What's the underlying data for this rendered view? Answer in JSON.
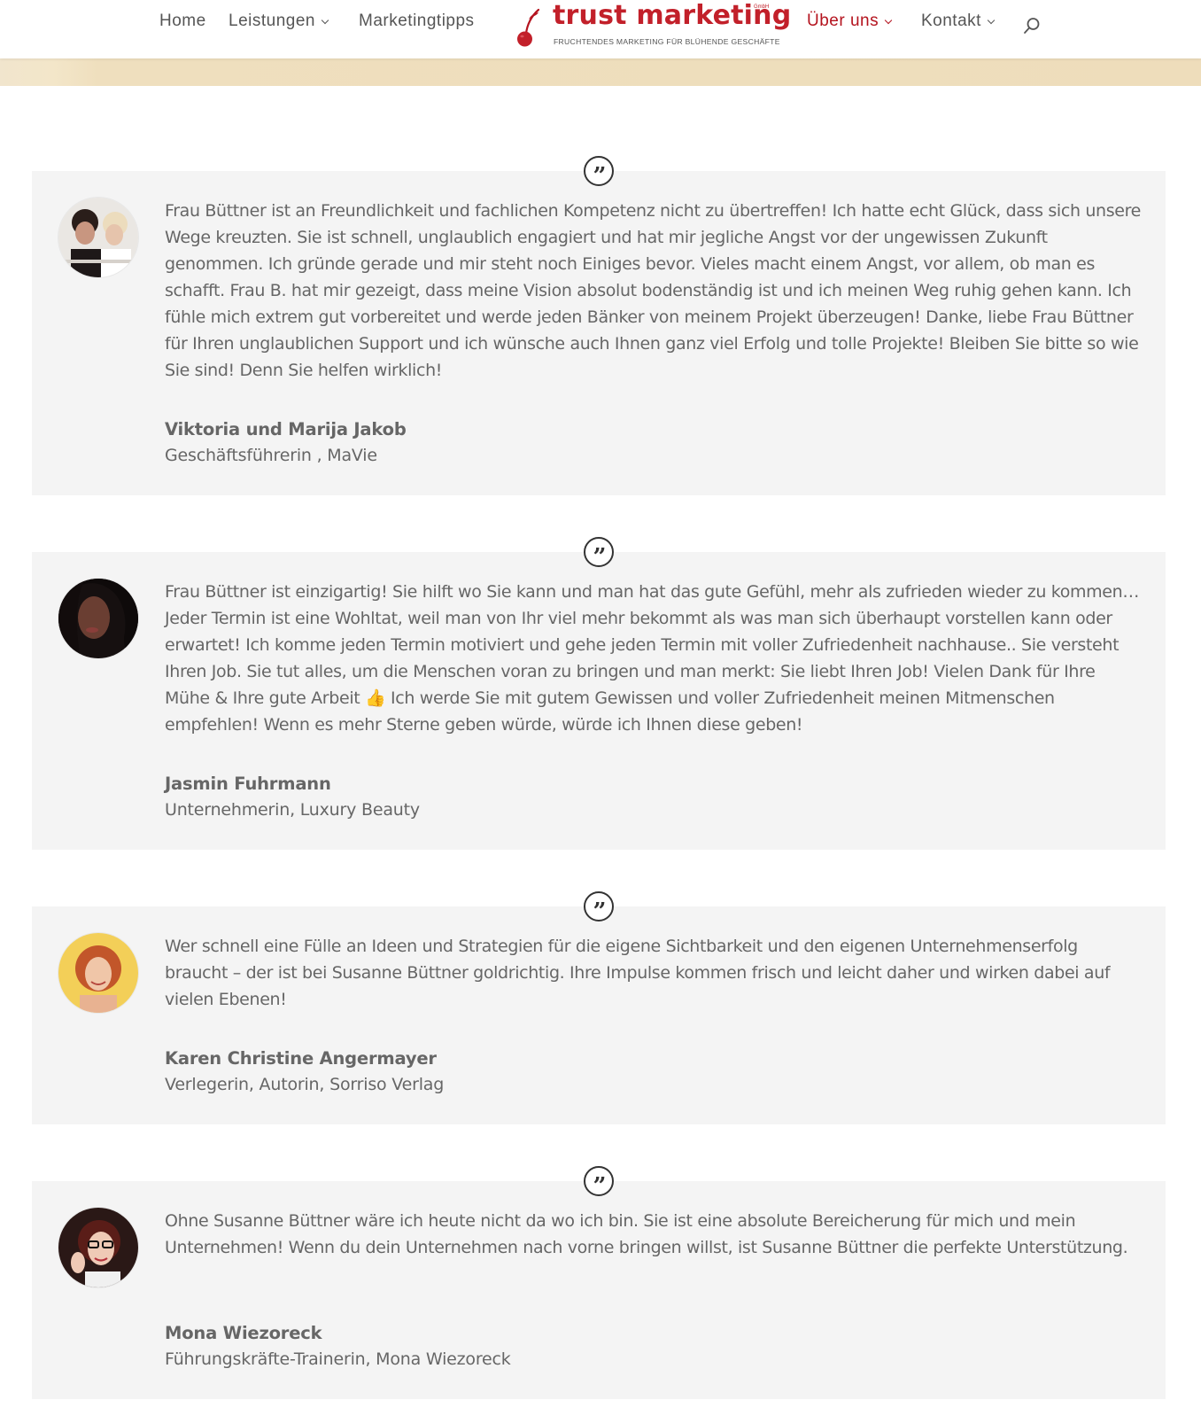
{
  "nav": {
    "left": [
      {
        "label": "Home",
        "has_dropdown": false
      },
      {
        "label": "Leistungen",
        "has_dropdown": true
      },
      {
        "label": "Marketingtipps",
        "has_dropdown": false
      }
    ],
    "right": [
      {
        "label": "Über uns",
        "has_dropdown": true,
        "active": true
      },
      {
        "label": "Kontakt",
        "has_dropdown": true
      }
    ]
  },
  "logo": {
    "name": "trust marketing",
    "suffix": "GmbH",
    "tagline": "FRUCHTENDES MARKETING FÜR BLÜHENDE GESCHÄFTE",
    "icon": "cherry-icon"
  },
  "icons": {
    "search": "search-icon",
    "quote": "quote-icon",
    "dropdown": "chevron-down-icon"
  },
  "quote_mark": "”",
  "colors": {
    "brand": "#c2202a",
    "nav_active": "#b4131e",
    "card_bg": "#f4f4f4",
    "text": "#666666",
    "banner": "#efdfbe"
  },
  "testimonials": [
    {
      "text": "Frau Büttner ist an Freundlichkeit und fachlichen Kompetenz nicht zu übertreffen! Ich hatte echt Glück, dass sich unsere Wege kreuzten. Sie ist schnell, unglaublich engagiert und hat mir jegliche Angst vor der ungewissen Zukunft genommen. Ich gründe gerade und mir steht noch Einiges bevor. Vieles macht einem Angst, vor allem, ob man es schafft. Frau B. hat mir gezeigt, dass meine Vision absolut bodenständig ist und ich meinen Weg ruhig gehen kann. Ich fühle mich extrem gut vorbereitet und werde jeden Bänker von meinem Projekt überzeugen! Danke, liebe Frau Büttner für Ihren unglaublichen Support und ich wünsche auch Ihnen ganz viel Erfolg und tolle Projekte! Bleiben Sie bitte so wie Sie sind! Denn Sie helfen wirklich!",
      "author": "Viktoria und Marija Jakob",
      "position": "Geschäftsführerin , MaVie"
    },
    {
      "text": "Frau Büttner ist einzigartig! Sie hilft wo Sie kann und man hat das gute Gefühl, mehr als zufrieden wieder zu kommen… Jeder Termin ist eine Wohltat, weil man von Ihr viel mehr bekommt als was man sich überhaupt vorstellen kann oder erwartet! Ich komme jeden Termin motiviert und gehe jeden Termin mit voller Zufriedenheit nachhause.. Sie versteht Ihren Job. Sie tut alles, um die Menschen voran zu bringen und man merkt: Sie liebt Ihren Job! Vielen Dank für Ihre Mühe & Ihre gute Arbeit 👍 Ich werde Sie mit gutem Gewissen und voller Zufriedenheit meinen Mitmenschen empfehlen! Wenn es mehr Sterne geben würde, würde ich Ihnen diese geben!",
      "author": "Jasmin Fuhrmann",
      "position": "Unternehmerin, Luxury Beauty"
    },
    {
      "text": "Wer schnell eine Fülle an Ideen und Strategien für die eigene Sichtbarkeit und den eigenen Unternehmenserfolg braucht – der ist bei Susanne Büttner goldrichtig. Ihre Impulse kommen frisch und leicht daher und wirken dabei auf vielen Ebenen!",
      "author": "Karen Christine Angermayer",
      "position": "Verlegerin, Autorin, Sorriso Verlag"
    },
    {
      "text": "Ohne Susanne Büttner wäre ich heute nicht da wo ich bin. Sie ist eine absolute Bereicherung für mich und mein Unternehmen! Wenn du dein Unternehmen nach vorne bringen willst, ist Susanne Büttner die perfekte Unterstützung.",
      "author": "Mona Wiezoreck",
      "position": "Führungskräfte-Trainerin, Mona Wiezoreck"
    }
  ]
}
